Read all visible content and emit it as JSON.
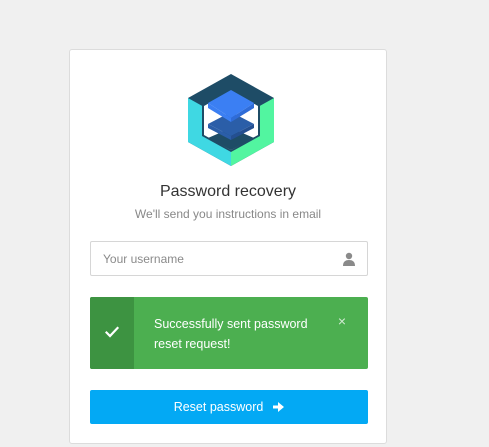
{
  "recovery": {
    "title": "Password recovery",
    "subtitle": "We'll send you instructions in email",
    "username_placeholder": "Your username",
    "username_value": "",
    "alert_message": "Successfully sent password reset request!",
    "alert_close": "×",
    "submit_label": "Reset password"
  },
  "icons": {
    "logo": "layered-cube-logo-icon",
    "user": "user-icon",
    "check": "check-icon",
    "close": "close-icon",
    "arrow": "arrow-right-icon"
  },
  "colors": {
    "success": "#4caf50",
    "success_dark": "#3d9341",
    "primary": "#03a9f4",
    "logo_dark": "#1e4c66",
    "logo_cyan": "#3fd8e3",
    "logo_green": "#52f5a0",
    "logo_blue": "#3b7ff3"
  }
}
